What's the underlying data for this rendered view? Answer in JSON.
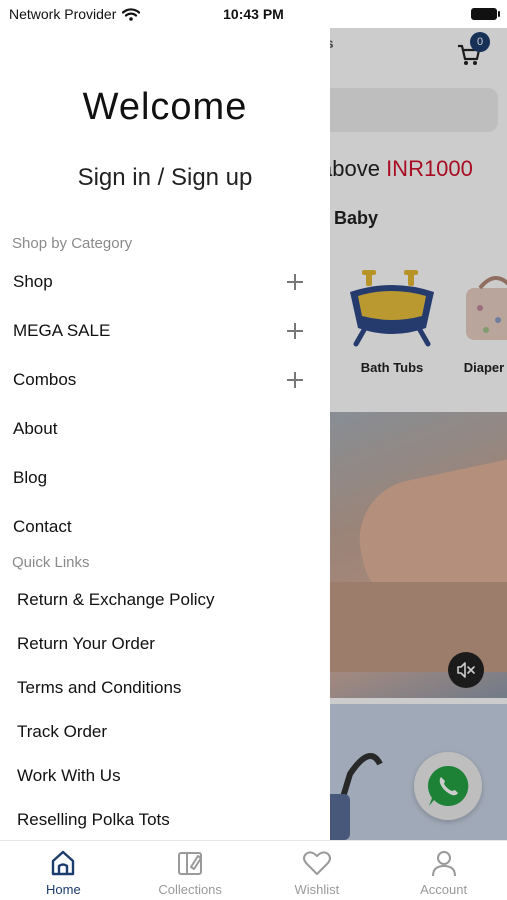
{
  "status_bar": {
    "carrier": "Network Provider",
    "time": "10:43 PM"
  },
  "background": {
    "cart_count": "0",
    "promo_text": "above ",
    "promo_highlight": "INR1000",
    "category_heading": "Baby",
    "categories": [
      {
        "label": "Bath Tubs",
        "icon": "bath-tub-icon"
      },
      {
        "label": "Diaper",
        "icon": "diaper-bag-icon"
      }
    ]
  },
  "drawer": {
    "welcome": "Welcome",
    "signin": "Sign in / Sign up",
    "shop_by_category_label": "Shop by Category",
    "categories": [
      {
        "label": "Shop",
        "expandable": true
      },
      {
        "label": "MEGA SALE",
        "expandable": true
      },
      {
        "label": "Combos",
        "expandable": true
      },
      {
        "label": "About",
        "expandable": false
      },
      {
        "label": "Blog",
        "expandable": false
      },
      {
        "label": "Contact",
        "expandable": false
      }
    ],
    "quick_links_label": "Quick Links",
    "quick_links": [
      "Return & Exchange Policy",
      "Return Your Order",
      "Terms and Conditions",
      "Track Order",
      "Work With Us",
      "Reselling Polka Tots"
    ]
  },
  "bottom_nav": {
    "items": [
      {
        "label": "Home",
        "icon": "home-icon",
        "active": true
      },
      {
        "label": "Collections",
        "icon": "collections-icon",
        "active": false
      },
      {
        "label": "Wishlist",
        "icon": "heart-icon",
        "active": false
      },
      {
        "label": "Account",
        "icon": "account-icon",
        "active": false
      }
    ]
  },
  "colors": {
    "accent": "#1d3c6e",
    "promo_highlight": "#d2112b",
    "muted_label": "#8a8a8a",
    "whatsapp": "#25a244"
  }
}
